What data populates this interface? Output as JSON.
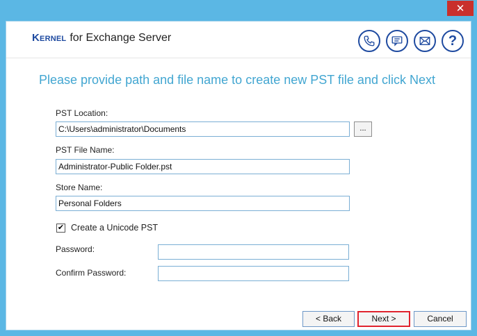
{
  "window": {
    "close_glyph": "✕"
  },
  "header": {
    "brand_logo_first": "K",
    "brand_logo_rest": "ERNEL",
    "brand_product": "for Exchange Server",
    "help_glyph": "?"
  },
  "instruction": "Please provide path and file name to create new PST file and click Next",
  "form": {
    "pst_location_label": "PST Location:",
    "pst_location_value": "C:\\Users\\administrator\\Documents",
    "browse_label": "...",
    "pst_file_name_label": "PST File Name:",
    "pst_file_name_value": "Administrator-Public Folder.pst",
    "store_name_label": "Store Name:",
    "store_name_value": "Personal Folders",
    "unicode_checked": true,
    "unicode_label": "Create a Unicode PST",
    "password_label": "Password:",
    "password_value": "",
    "confirm_password_label": "Confirm Password:",
    "confirm_password_value": ""
  },
  "buttons": {
    "back": "< Back",
    "next": "Next >",
    "cancel": "Cancel"
  },
  "icons": [
    "phone-icon",
    "chat-icon",
    "mail-icon",
    "help-icon"
  ],
  "colors": {
    "title_bar": "#5bb7e4",
    "close_button": "#c9302c",
    "brand_blue": "#1e4aa0",
    "instruction_text": "#42a6d1",
    "focus_border": "#e0232e"
  }
}
